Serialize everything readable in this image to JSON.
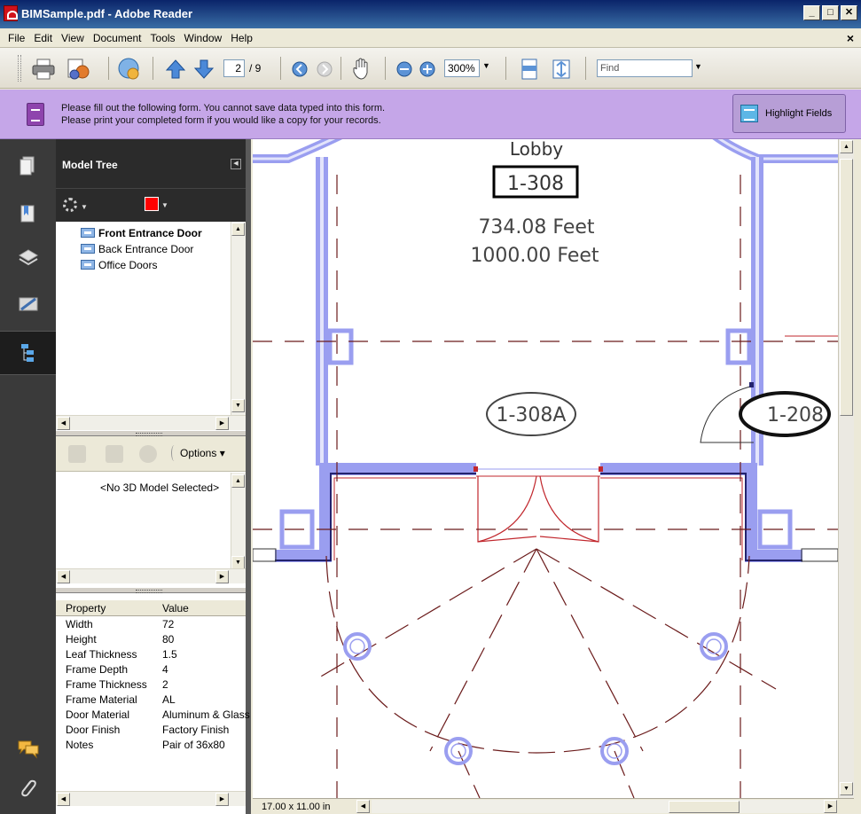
{
  "window": {
    "title": "BIMSample.pdf - Adobe Reader",
    "min": "_",
    "max": "□",
    "close": "✕"
  },
  "menu": {
    "items": [
      "File",
      "Edit",
      "View",
      "Document",
      "Tools",
      "Window",
      "Help"
    ],
    "close": "×"
  },
  "toolbar": {
    "page_current": "2",
    "page_total": "/ 9",
    "zoom": "300%",
    "find_placeholder": "Find",
    "dropdown": "▼"
  },
  "banner": {
    "line1": "Please fill out the following form. You cannot save data typed into this form.",
    "line2": "Please print your completed form if you would like a copy for your records.",
    "highlight_label": "Highlight Fields"
  },
  "panel": {
    "title": "Model Tree",
    "tree_items": [
      "Front Entrance Door",
      "Back Entrance Door",
      "Office Doors"
    ],
    "options_label": "Options",
    "no_model": "<No 3D Model Selected>",
    "props_header": {
      "property": "Property",
      "value": "Value"
    },
    "properties": [
      {
        "k": "Width",
        "v": "72"
      },
      {
        "k": "Height",
        "v": "80"
      },
      {
        "k": "Leaf Thickness",
        "v": "1.5"
      },
      {
        "k": "Frame Depth",
        "v": "4"
      },
      {
        "k": "Frame Thickness",
        "v": "2"
      },
      {
        "k": "Frame Material",
        "v": "AL"
      },
      {
        "k": "Door Material",
        "v": "Aluminum & Glass"
      },
      {
        "k": "Door Finish",
        "v": "Factory Finish"
      },
      {
        "k": "Notes",
        "v": "Pair of 36x80"
      }
    ]
  },
  "drawing": {
    "room_name": "Lobby",
    "room_number": "1-308",
    "dim1": "734.08 Feet",
    "dim2": "1000.00 Feet",
    "door_tag_1": "1-308A",
    "door_tag_2": "1-208"
  },
  "status": {
    "page_size": "17.00 x 11.00 in"
  },
  "colors": {
    "wall_fill": "#9a9ef0",
    "wall_line": "#23236e",
    "grid_line": "#6b1b1b",
    "door": "#c1272d",
    "banner": "#c5a6e8"
  }
}
